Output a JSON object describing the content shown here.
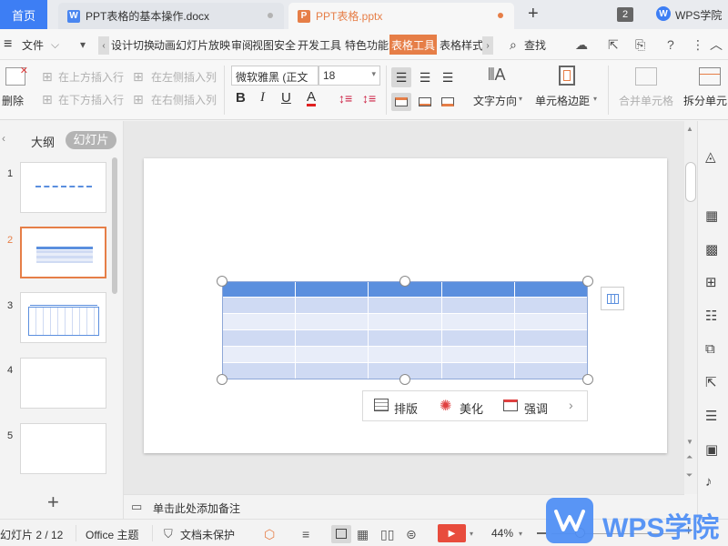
{
  "tabs": {
    "home": "首页",
    "doc1": "PPT表格的基本操作.docx",
    "doc2": "PPT表格.pptx",
    "add": "+",
    "count": "2",
    "account": "WPS学院"
  },
  "menu": {
    "file": "文件",
    "items": [
      "设计",
      "切换",
      "动画",
      "幻灯片放映",
      "审阅",
      "视图",
      "安全",
      "开发工具",
      "特色功能"
    ],
    "active_tab": "表格工具",
    "style_tab": "表格样式",
    "search": "查找"
  },
  "ribbon": {
    "delete": "删除",
    "insert_above": "在上方插入行",
    "insert_below": "在下方插入行",
    "insert_left": "在左侧插入列",
    "insert_right": "在右侧插入列",
    "font": "微软雅黑 (正文",
    "size": "18",
    "bold": "B",
    "italic": "I",
    "underline": "U",
    "fontcolor": "A",
    "text_direction": "文字方向",
    "cell_margin": "单元格边距",
    "merge": "合并单元格",
    "split": "拆分单元"
  },
  "left": {
    "outline": "大纲",
    "slides": "幻灯片",
    "numbers": [
      "1",
      "2",
      "3",
      "4",
      "5"
    ],
    "add": "+"
  },
  "float": {
    "layout": "排版",
    "beautify": "美化",
    "emphasis": "强调"
  },
  "notes": "单击此处添加备注",
  "status": {
    "slide": "幻灯片 2 / 12",
    "theme": "Office 主题",
    "protect": "文档未保护",
    "zoom": "44%"
  },
  "watermark": "WPS学院",
  "colors": {
    "accent": "#e67e47",
    "brand": "#3d7ef4",
    "table_header": "#5b8fde",
    "table_row_a": "#cfdaf3",
    "table_row_b": "#e8edf9"
  }
}
